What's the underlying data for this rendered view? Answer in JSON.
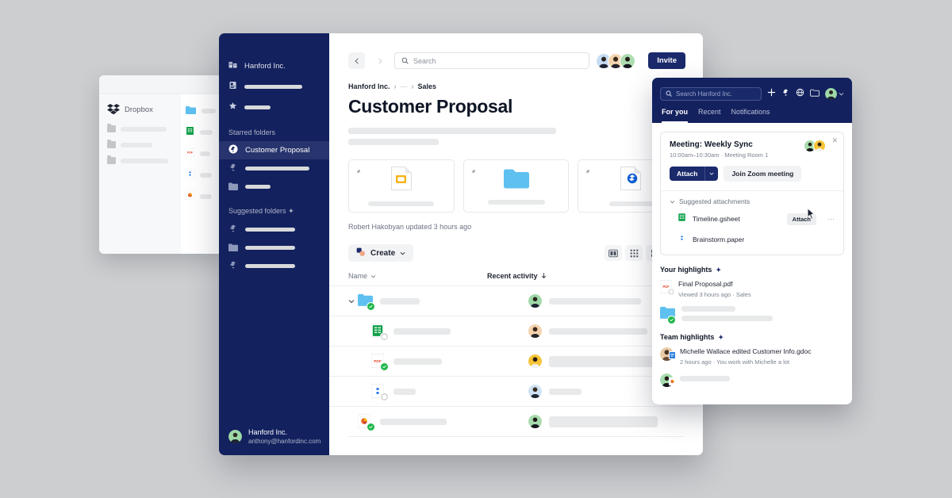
{
  "theme": {
    "page_bg": "#cdced0",
    "navy": "#13215e",
    "navy_active": "#27346d",
    "button_navy": "#1b2a6b",
    "sync_green": "#21b84b",
    "folder_blue": "#5ec0ef"
  },
  "back_window": {
    "brand": "Dropbox",
    "sidebar_items": [
      {
        "icon": "folder-icon"
      },
      {
        "icon": "folder-icon"
      },
      {
        "icon": "folder-icon"
      }
    ],
    "file_rows": [
      {
        "icon": "folder-icon"
      },
      {
        "icon": "gsheet-icon"
      },
      {
        "icon": "pdf-icon"
      },
      {
        "icon": "paper-icon"
      },
      {
        "icon": "slides-icon"
      }
    ]
  },
  "sidebar": {
    "org_name": "Hanford Inc.",
    "org_icon": "org-building-icon",
    "nav_items": [
      {
        "icon": "document-icon"
      },
      {
        "icon": "star-icon"
      }
    ],
    "starred_label": "Starred folders",
    "starred_items": [
      {
        "label": "Customer Proposal",
        "icon": "dropbox-folder-icon",
        "active": true
      },
      {
        "label": "",
        "icon": "dropbox-folder-icon",
        "active": false
      },
      {
        "label": "",
        "icon": "folder-icon",
        "active": false
      }
    ],
    "suggested_label": "Suggested folders",
    "suggested_sparkle": "✦",
    "suggested_items": [
      {
        "icon": "dropbox-folder-icon"
      },
      {
        "icon": "folder-icon"
      },
      {
        "icon": "dropbox-folder-icon"
      }
    ],
    "account": {
      "name": "Hanford Inc.",
      "email": "anthony@hanfordinc.com",
      "avatar": "user-avatar"
    }
  },
  "topbar": {
    "back_icon": "chevron-left-icon",
    "forward_icon": "chevron-right-icon",
    "search_icon": "search-icon",
    "search_placeholder": "Search",
    "search_value": "",
    "invite_label": "Invite",
    "avatar_count": 3
  },
  "breadcrumb": {
    "root": "Hanford Inc.",
    "ellipsis": "···",
    "current": "Sales",
    "separator": "›"
  },
  "page": {
    "title": "Customer Proposal",
    "updated_text": "Robert Hakobyan updated 3 hours ago"
  },
  "pinned_cards": [
    {
      "icon": "gslides-icon",
      "pin_icon": "pin-icon"
    },
    {
      "icon": "folder-icon",
      "pin_icon": "pin-icon"
    },
    {
      "icon": "paper-doc-icon",
      "pin_icon": "pin-icon"
    }
  ],
  "toolbar": {
    "create_label": "Create",
    "create_icon": "create-icon",
    "create_caret": "chevron-down-icon",
    "views": [
      {
        "name": "preview-view",
        "icon": "preview-icon",
        "active": false
      },
      {
        "name": "small-grid-view",
        "icon": "grid-small-icon",
        "active": false
      },
      {
        "name": "large-grid-view",
        "icon": "grid-large-icon",
        "active": false
      },
      {
        "name": "list-view",
        "icon": "list-icon",
        "active": true
      }
    ]
  },
  "table": {
    "col_name": "Name",
    "col_name_caret": "chevron-down-icon",
    "col_activity": "Recent activity",
    "col_activity_sort": "arrow-down-icon",
    "rows": [
      {
        "icon": "folder-icon",
        "badge": "synced",
        "expandable": true,
        "name_w": 50,
        "activity_w": 116
      },
      {
        "icon": "gsheet-icon",
        "badge": "syncing",
        "expandable": false,
        "name_w": 72,
        "activity_w": 124
      },
      {
        "icon": "pdf-icon",
        "badge": "synced",
        "expandable": false,
        "name_w": 61,
        "activity_w": 137
      },
      {
        "icon": "paper-icon",
        "badge": "syncing",
        "expandable": false,
        "name_w": 28,
        "activity_w": 41
      },
      {
        "icon": "slides-icon",
        "badge": "synced",
        "expandable": false,
        "name_w": 84,
        "activity_w": 137
      }
    ]
  },
  "popup": {
    "search_icon": "search-icon",
    "search_placeholder": "Search Hanford Inc.",
    "search_value": "",
    "header_icons": [
      {
        "name": "plus-icon"
      },
      {
        "name": "dropbox-icon"
      },
      {
        "name": "globe-icon"
      },
      {
        "name": "folder-icon"
      }
    ],
    "avatar": "user-avatar",
    "avatar_caret": "chevron-down-icon",
    "tabs": [
      {
        "label": "For you",
        "active": true
      },
      {
        "label": "Recent",
        "active": false
      },
      {
        "label": "Notifications",
        "active": false
      }
    ],
    "meeting": {
      "title": "Meeting: Weekly Sync",
      "subtitle": "10:00am–10:30am · Meeting Room 1",
      "attach_label": "Attach",
      "attach_caret": "chevron-down-icon",
      "zoom_label": "Join Zoom meeting",
      "close_icon": "close-icon",
      "avatar_count": 2,
      "suggested_label": "Suggested attachments",
      "suggested_caret": "chevron-down-icon",
      "attachments": [
        {
          "name": "Timeline.gsheet",
          "icon": "gsheet-icon",
          "attach_label": "Attach",
          "more_icon": "more-dots-icon",
          "hovered": true
        },
        {
          "name": "Brainstorm.paper",
          "icon": "paper-icon",
          "attach_label": "",
          "more_icon": "",
          "hovered": false
        }
      ]
    },
    "your_highlights": {
      "heading": "Your highlights",
      "sparkle": "✦",
      "items": [
        {
          "title": "Final Proposal.pdf",
          "meta": "Viewed 3 hours ago · Sales",
          "icon": "pdf-icon",
          "badge": "syncing"
        },
        {
          "title": "",
          "meta": "",
          "icon": "folder-icon",
          "badge": "synced"
        }
      ]
    },
    "team_highlights": {
      "heading": "Team highlights",
      "sparkle": "✦",
      "items": [
        {
          "title": "Michelle Wallace edited Customer Info.gdoc",
          "meta": "2 hours ago · You work with Michelle a lot",
          "avatar": "user-avatar",
          "badge_icon": "gdoc-icon"
        },
        {
          "title": "",
          "meta": "",
          "avatar": "user-avatar",
          "badge_icon": "slides-icon"
        }
      ]
    }
  },
  "cursor": {
    "icon": "mouse-pointer-icon"
  }
}
